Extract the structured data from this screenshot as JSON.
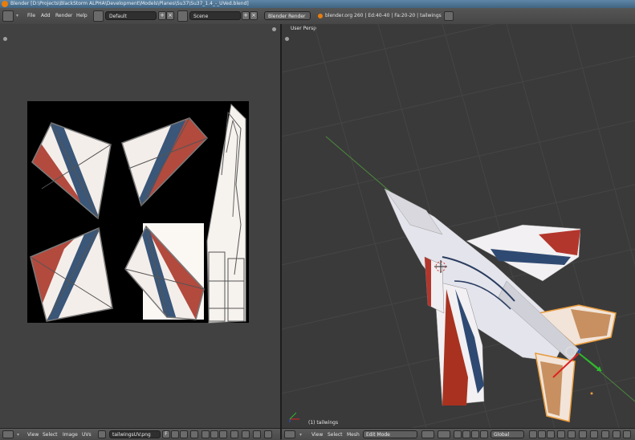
{
  "window": {
    "title": "Blender [D:\\Projects\\BlackStorm ALPHA\\Development\\Models\\Planes\\Su37\\Su37_1.4_-_UVed.blend]"
  },
  "info_header": {
    "menus": [
      "File",
      "Add",
      "Render",
      "Help"
    ],
    "screen_layout": "Default",
    "scene": "Scene",
    "render_engine": "Blender Render",
    "stats": "blender.org 260 | Ed:40-40 | Fa:20-20 | tailwings"
  },
  "uv_editor": {
    "menus": [
      "View",
      "Select",
      "Image",
      "UVs"
    ],
    "image_name": "tailwingsUV.png",
    "pin_label": "F"
  },
  "viewport": {
    "view_label": "User Persp",
    "object_label": "(1) tailwings",
    "menus": [
      "View",
      "Select",
      "Mesh"
    ],
    "mode": "Edit Mode",
    "orientation": "Global"
  },
  "icons": {
    "logo": "blender-logo-icon",
    "editor_type": "editor-type-icon",
    "close": "close-icon",
    "add": "add-icon"
  },
  "colors": {
    "accent": "#e87d0d",
    "red_stripe": "#b0463a",
    "blue_stripe": "#3a5678",
    "selection": "#e89a3c"
  }
}
